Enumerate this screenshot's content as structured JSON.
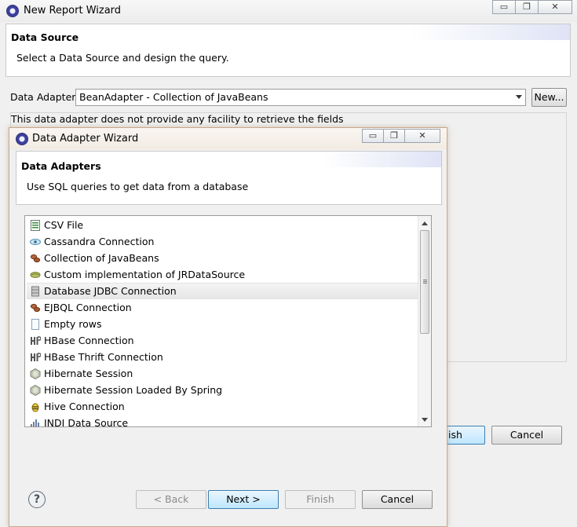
{
  "background_window": {
    "title": "New Report Wizard",
    "header_title": "Data Source",
    "header_desc": "Select a Data Source and design the query.",
    "adapter_label": "Data Adapter",
    "adapter_value": "BeanAdapter - Collection of JavaBeans",
    "new_button": "New...",
    "info_text": "This data adapter does not provide any facility to retrieve the fields",
    "finish_button_partial": "ish",
    "cancel_button": "Cancel",
    "controls": {
      "minimize": "▭",
      "restore": "❐",
      "close": "✕"
    }
  },
  "dialog": {
    "title": "Data Adapter Wizard",
    "header_title": "Data Adapters",
    "header_desc": "Use SQL queries to get data from a database",
    "controls": {
      "minimize": "▭",
      "restore": "❐",
      "close": "✕"
    },
    "items": [
      {
        "label": "CSV File",
        "icon": "csv-file-icon"
      },
      {
        "label": "Cassandra Connection",
        "icon": "cassandra-eye-icon"
      },
      {
        "label": "Collection of JavaBeans",
        "icon": "beans-icon"
      },
      {
        "label": "Custom implementation of JRDataSource",
        "icon": "bean-green-icon"
      },
      {
        "label": "Database JDBC Connection",
        "icon": "database-icon",
        "selected": true
      },
      {
        "label": "EJBQL Connection",
        "icon": "beans-icon"
      },
      {
        "label": "Empty rows",
        "icon": "empty-page-icon"
      },
      {
        "label": "HBase Connection",
        "icon": "hbase-icon"
      },
      {
        "label": "HBase Thrift Connection",
        "icon": "hbase-icon"
      },
      {
        "label": "Hibernate Session",
        "icon": "hibernate-icon"
      },
      {
        "label": "Hibernate Session Loaded By Spring",
        "icon": "hibernate-icon"
      },
      {
        "label": "Hive Connection",
        "icon": "hive-bee-icon"
      },
      {
        "label": "JNDI Data Source",
        "icon": "jndi-icon"
      }
    ],
    "help": "?",
    "back_button": "< Back",
    "next_button": "Next >",
    "finish_button": "Finish",
    "cancel_button": "Cancel"
  },
  "colors": {
    "selection": "#e6e6e6",
    "primary_button": "#bee6fd",
    "dialog_border": "#c5a98a"
  }
}
